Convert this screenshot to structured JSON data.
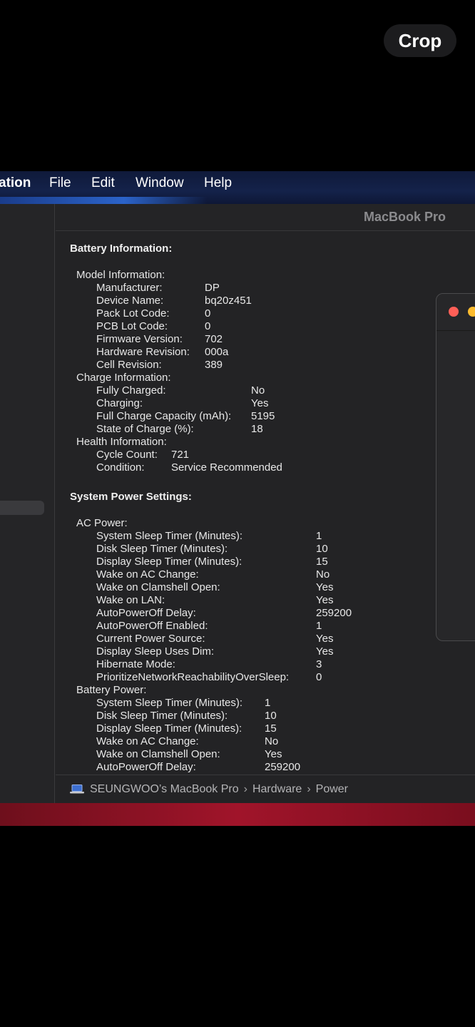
{
  "overlay": {
    "crop_label": "Crop"
  },
  "menubar": {
    "app_name": "ation",
    "items": [
      "File",
      "Edit",
      "Window",
      "Help"
    ]
  },
  "window": {
    "header_title": "MacBook Pro",
    "battery_title": "Battery Information:",
    "model_info": {
      "label": "Model Information:",
      "rows": [
        {
          "k": "Manufacturer:",
          "v": "DP"
        },
        {
          "k": "Device Name:",
          "v": "bq20z451"
        },
        {
          "k": "Pack Lot Code:",
          "v": "0"
        },
        {
          "k": "PCB Lot Code:",
          "v": "0"
        },
        {
          "k": "Firmware Version:",
          "v": "702"
        },
        {
          "k": "Hardware Revision:",
          "v": "000a"
        },
        {
          "k": "Cell Revision:",
          "v": "389"
        }
      ]
    },
    "charge_info": {
      "label": "Charge Information:",
      "rows": [
        {
          "k": "Fully Charged:",
          "v": "No"
        },
        {
          "k": "Charging:",
          "v": "Yes"
        },
        {
          "k": "Full Charge Capacity (mAh):",
          "v": "5195"
        },
        {
          "k": "State of Charge (%):",
          "v": "18"
        }
      ]
    },
    "health_info": {
      "label": "Health Information:",
      "rows": [
        {
          "k": "Cycle Count:",
          "v": "721"
        },
        {
          "k": "Condition:",
          "v": "Service Recommended"
        }
      ]
    },
    "power_title": "System Power Settings:",
    "ac_power": {
      "label": "AC Power:",
      "rows": [
        {
          "k": "System Sleep Timer (Minutes):",
          "v": "1"
        },
        {
          "k": "Disk Sleep Timer (Minutes):",
          "v": "10"
        },
        {
          "k": "Display Sleep Timer (Minutes):",
          "v": "15"
        },
        {
          "k": "Wake on AC Change:",
          "v": "No"
        },
        {
          "k": "Wake on Clamshell Open:",
          "v": "Yes"
        },
        {
          "k": "Wake on LAN:",
          "v": "Yes"
        },
        {
          "k": "AutoPowerOff Delay:",
          "v": "259200"
        },
        {
          "k": "AutoPowerOff Enabled:",
          "v": "1"
        },
        {
          "k": "Current Power Source:",
          "v": "Yes"
        },
        {
          "k": "Display Sleep Uses Dim:",
          "v": "Yes"
        },
        {
          "k": "Hibernate Mode:",
          "v": "3"
        },
        {
          "k": "PrioritizeNetworkReachabilityOverSleep:",
          "v": "0"
        }
      ]
    },
    "battery_power": {
      "label": "Battery Power:",
      "rows": [
        {
          "k": "System Sleep Timer (Minutes):",
          "v": "1"
        },
        {
          "k": "Disk Sleep Timer (Minutes):",
          "v": "10"
        },
        {
          "k": "Display Sleep Timer (Minutes):",
          "v": "15"
        },
        {
          "k": "Wake on AC Change:",
          "v": "No"
        },
        {
          "k": "Wake on Clamshell Open:",
          "v": "Yes"
        },
        {
          "k": "AutoPowerOff Delay:",
          "v": "259200"
        }
      ]
    },
    "pathbar": {
      "icon": "laptop-icon",
      "crumbs": [
        "SEUNGWOO’s MacBook Pro",
        "Hardware",
        "Power"
      ],
      "separator": "›"
    }
  },
  "colors": {
    "window_bg": "#232325",
    "menubar_bg": "#14224a",
    "close_dot": "#ff5f57",
    "minimize_dot": "#febc2e",
    "dock_red": "#a0142a"
  }
}
